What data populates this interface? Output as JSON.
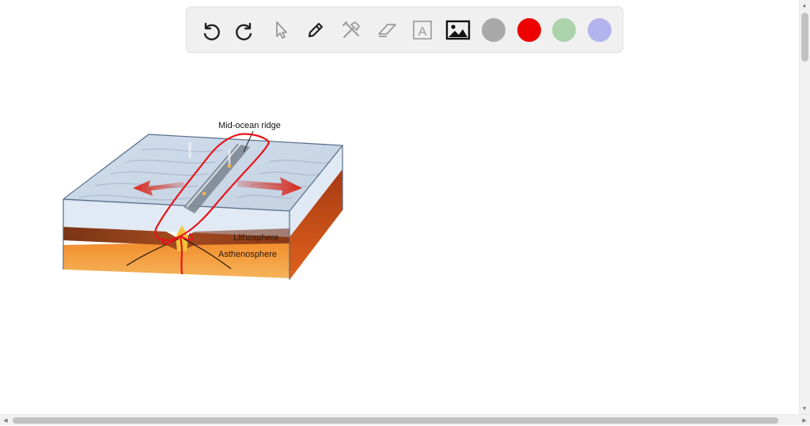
{
  "toolbar": {
    "tools": [
      {
        "name": "undo-icon"
      },
      {
        "name": "redo-icon"
      },
      {
        "name": "pointer-icon"
      },
      {
        "name": "pen-icon"
      },
      {
        "name": "tools-icon"
      },
      {
        "name": "eraser-icon"
      },
      {
        "name": "text-icon",
        "glyph": "A"
      },
      {
        "name": "image-icon"
      }
    ],
    "colors": [
      "#a9a9a9",
      "#ee0000",
      "#acd3ac",
      "#b3b3ee"
    ]
  },
  "diagram": {
    "label_ridge": "Mid-ocean ridge",
    "label_lithosphere": "Lithosphere",
    "label_asthenosphere": "Asthenosphere"
  },
  "scrollbars": {
    "up_arrow": "▲",
    "down_arrow": "▼",
    "left_arrow": "◀",
    "right_arrow": "▶"
  }
}
